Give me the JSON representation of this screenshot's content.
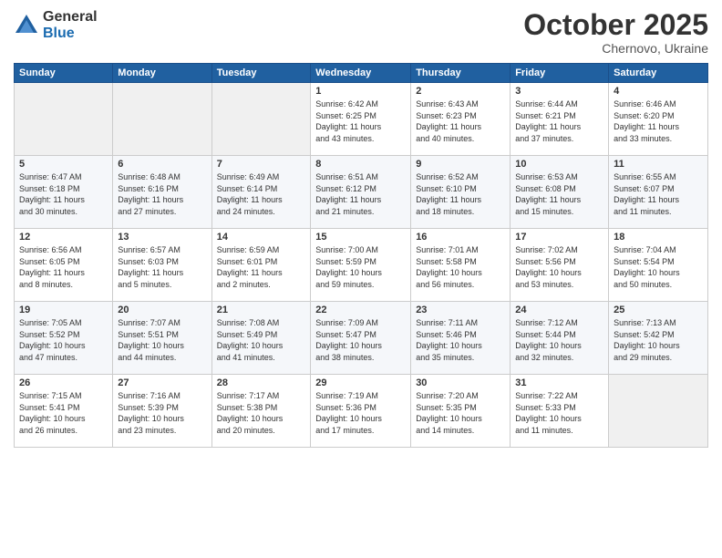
{
  "logo": {
    "general": "General",
    "blue": "Blue"
  },
  "header": {
    "month": "October 2025",
    "location": "Chernovo, Ukraine"
  },
  "weekdays": [
    "Sunday",
    "Monday",
    "Tuesday",
    "Wednesday",
    "Thursday",
    "Friday",
    "Saturday"
  ],
  "weeks": [
    [
      {
        "day": "",
        "info": ""
      },
      {
        "day": "",
        "info": ""
      },
      {
        "day": "",
        "info": ""
      },
      {
        "day": "1",
        "info": "Sunrise: 6:42 AM\nSunset: 6:25 PM\nDaylight: 11 hours\nand 43 minutes."
      },
      {
        "day": "2",
        "info": "Sunrise: 6:43 AM\nSunset: 6:23 PM\nDaylight: 11 hours\nand 40 minutes."
      },
      {
        "day": "3",
        "info": "Sunrise: 6:44 AM\nSunset: 6:21 PM\nDaylight: 11 hours\nand 37 minutes."
      },
      {
        "day": "4",
        "info": "Sunrise: 6:46 AM\nSunset: 6:20 PM\nDaylight: 11 hours\nand 33 minutes."
      }
    ],
    [
      {
        "day": "5",
        "info": "Sunrise: 6:47 AM\nSunset: 6:18 PM\nDaylight: 11 hours\nand 30 minutes."
      },
      {
        "day": "6",
        "info": "Sunrise: 6:48 AM\nSunset: 6:16 PM\nDaylight: 11 hours\nand 27 minutes."
      },
      {
        "day": "7",
        "info": "Sunrise: 6:49 AM\nSunset: 6:14 PM\nDaylight: 11 hours\nand 24 minutes."
      },
      {
        "day": "8",
        "info": "Sunrise: 6:51 AM\nSunset: 6:12 PM\nDaylight: 11 hours\nand 21 minutes."
      },
      {
        "day": "9",
        "info": "Sunrise: 6:52 AM\nSunset: 6:10 PM\nDaylight: 11 hours\nand 18 minutes."
      },
      {
        "day": "10",
        "info": "Sunrise: 6:53 AM\nSunset: 6:08 PM\nDaylight: 11 hours\nand 15 minutes."
      },
      {
        "day": "11",
        "info": "Sunrise: 6:55 AM\nSunset: 6:07 PM\nDaylight: 11 hours\nand 11 minutes."
      }
    ],
    [
      {
        "day": "12",
        "info": "Sunrise: 6:56 AM\nSunset: 6:05 PM\nDaylight: 11 hours\nand 8 minutes."
      },
      {
        "day": "13",
        "info": "Sunrise: 6:57 AM\nSunset: 6:03 PM\nDaylight: 11 hours\nand 5 minutes."
      },
      {
        "day": "14",
        "info": "Sunrise: 6:59 AM\nSunset: 6:01 PM\nDaylight: 11 hours\nand 2 minutes."
      },
      {
        "day": "15",
        "info": "Sunrise: 7:00 AM\nSunset: 5:59 PM\nDaylight: 10 hours\nand 59 minutes."
      },
      {
        "day": "16",
        "info": "Sunrise: 7:01 AM\nSunset: 5:58 PM\nDaylight: 10 hours\nand 56 minutes."
      },
      {
        "day": "17",
        "info": "Sunrise: 7:02 AM\nSunset: 5:56 PM\nDaylight: 10 hours\nand 53 minutes."
      },
      {
        "day": "18",
        "info": "Sunrise: 7:04 AM\nSunset: 5:54 PM\nDaylight: 10 hours\nand 50 minutes."
      }
    ],
    [
      {
        "day": "19",
        "info": "Sunrise: 7:05 AM\nSunset: 5:52 PM\nDaylight: 10 hours\nand 47 minutes."
      },
      {
        "day": "20",
        "info": "Sunrise: 7:07 AM\nSunset: 5:51 PM\nDaylight: 10 hours\nand 44 minutes."
      },
      {
        "day": "21",
        "info": "Sunrise: 7:08 AM\nSunset: 5:49 PM\nDaylight: 10 hours\nand 41 minutes."
      },
      {
        "day": "22",
        "info": "Sunrise: 7:09 AM\nSunset: 5:47 PM\nDaylight: 10 hours\nand 38 minutes."
      },
      {
        "day": "23",
        "info": "Sunrise: 7:11 AM\nSunset: 5:46 PM\nDaylight: 10 hours\nand 35 minutes."
      },
      {
        "day": "24",
        "info": "Sunrise: 7:12 AM\nSunset: 5:44 PM\nDaylight: 10 hours\nand 32 minutes."
      },
      {
        "day": "25",
        "info": "Sunrise: 7:13 AM\nSunset: 5:42 PM\nDaylight: 10 hours\nand 29 minutes."
      }
    ],
    [
      {
        "day": "26",
        "info": "Sunrise: 7:15 AM\nSunset: 5:41 PM\nDaylight: 10 hours\nand 26 minutes."
      },
      {
        "day": "27",
        "info": "Sunrise: 7:16 AM\nSunset: 5:39 PM\nDaylight: 10 hours\nand 23 minutes."
      },
      {
        "day": "28",
        "info": "Sunrise: 7:17 AM\nSunset: 5:38 PM\nDaylight: 10 hours\nand 20 minutes."
      },
      {
        "day": "29",
        "info": "Sunrise: 7:19 AM\nSunset: 5:36 PM\nDaylight: 10 hours\nand 17 minutes."
      },
      {
        "day": "30",
        "info": "Sunrise: 7:20 AM\nSunset: 5:35 PM\nDaylight: 10 hours\nand 14 minutes."
      },
      {
        "day": "31",
        "info": "Sunrise: 7:22 AM\nSunset: 5:33 PM\nDaylight: 10 hours\nand 11 minutes."
      },
      {
        "day": "",
        "info": ""
      }
    ]
  ]
}
